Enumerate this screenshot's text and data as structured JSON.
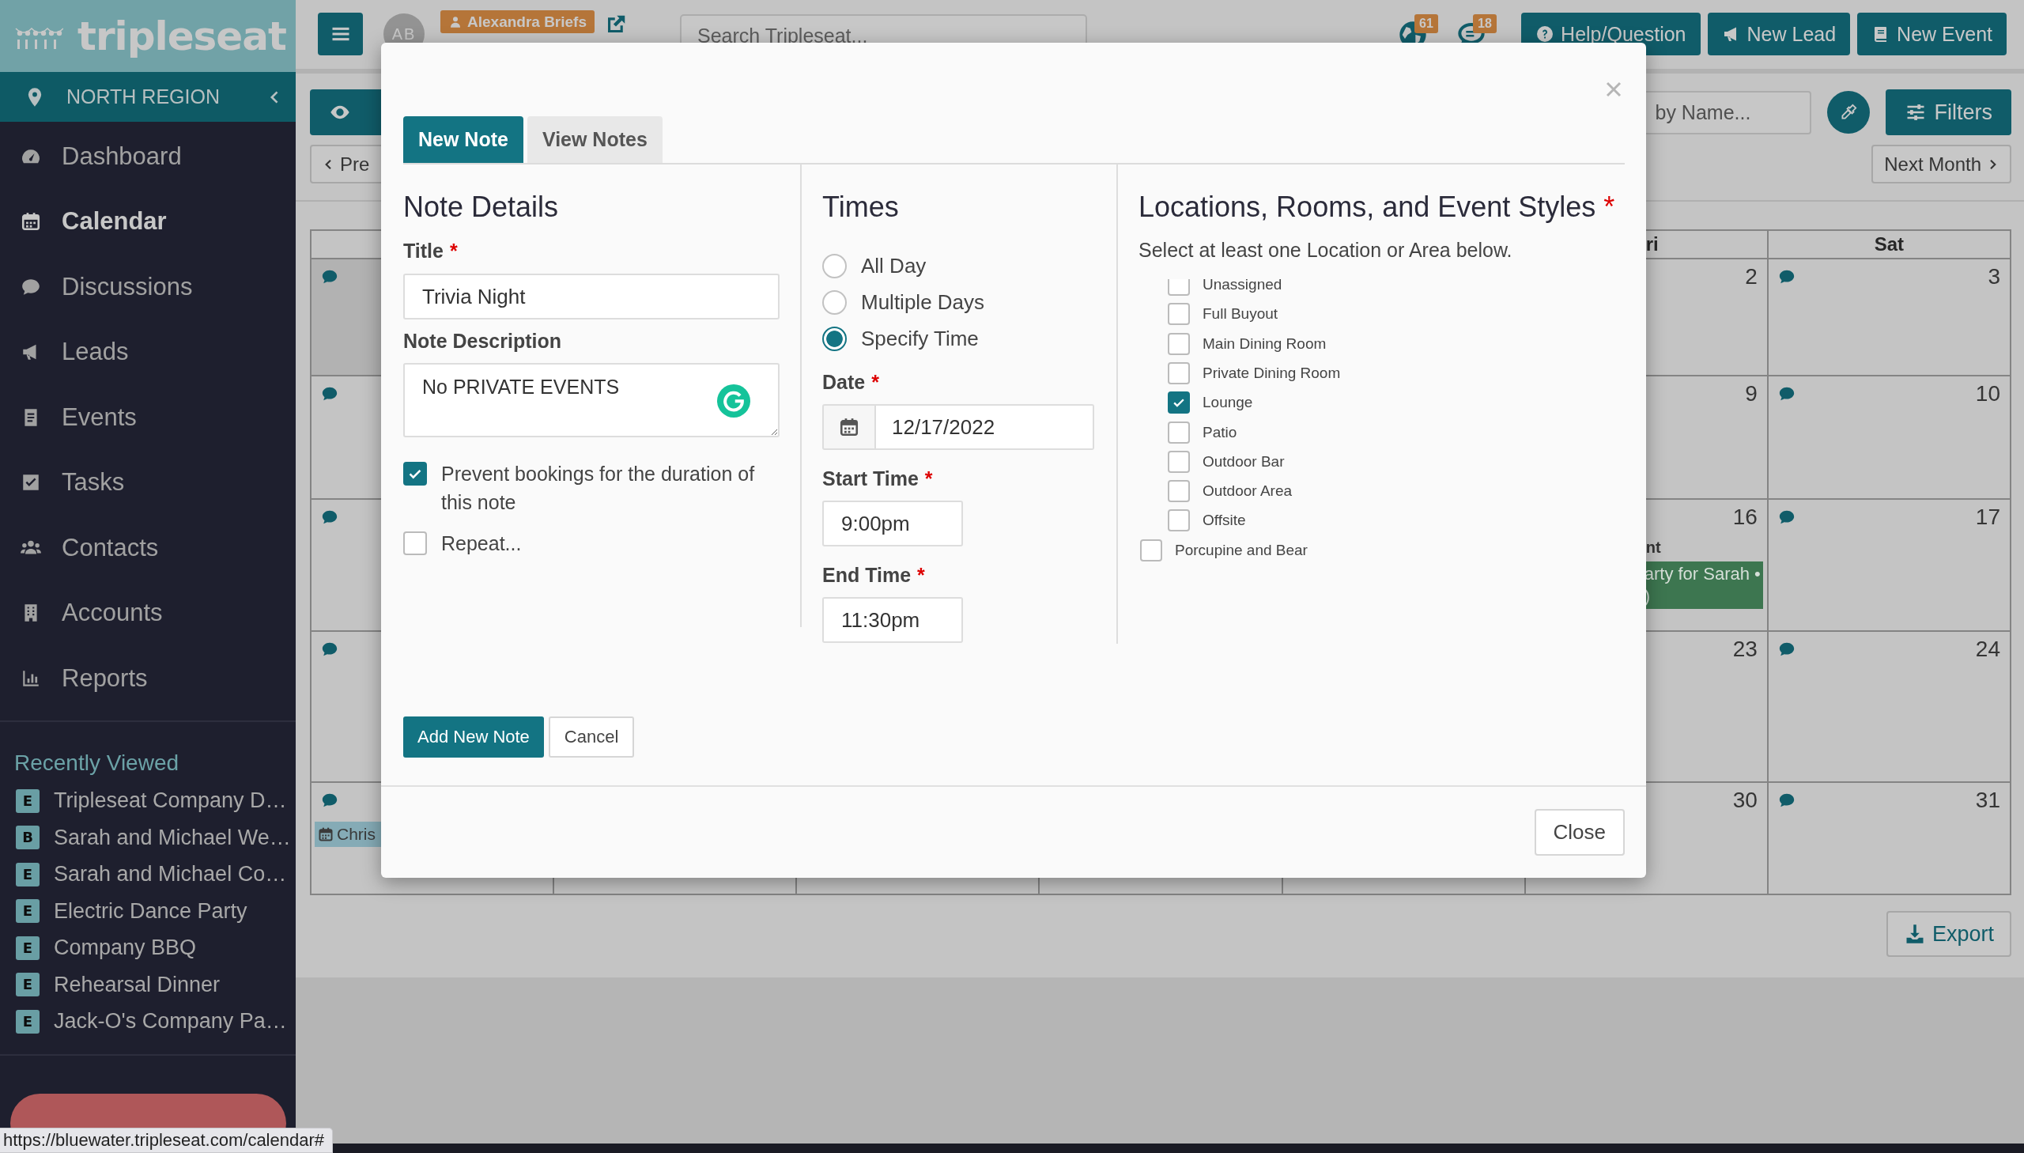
{
  "sidebar": {
    "logo": "tripleseat",
    "region": "NORTH REGION",
    "nav": [
      {
        "label": "Dashboard",
        "selected": false
      },
      {
        "label": "Calendar",
        "selected": true
      },
      {
        "label": "Discussions",
        "selected": false
      },
      {
        "label": "Leads",
        "selected": false
      },
      {
        "label": "Events",
        "selected": false
      },
      {
        "label": "Tasks",
        "selected": false
      },
      {
        "label": "Contacts",
        "selected": false
      },
      {
        "label": "Accounts",
        "selected": false
      },
      {
        "label": "Reports",
        "selected": false
      }
    ],
    "recently_viewed": {
      "title": "Recently Viewed",
      "items": [
        {
          "badge": "E",
          "label": "Tripleseat Company D…"
        },
        {
          "badge": "B",
          "label": "Sarah and Michael We…"
        },
        {
          "badge": "E",
          "label": "Sarah and Michael Co…"
        },
        {
          "badge": "E",
          "label": "Electric Dance Party"
        },
        {
          "badge": "E",
          "label": "Company BBQ"
        },
        {
          "badge": "E",
          "label": "Rehearsal Dinner"
        },
        {
          "badge": "E",
          "label": "Jack-O's Company Pa…"
        }
      ]
    }
  },
  "topbar": {
    "avatar": "AB",
    "user_badge": "Alexandra Briefs",
    "search": {
      "placeholder": "Search Tripleseat..."
    },
    "notifications": [
      {
        "count": "61"
      },
      {
        "count": "18"
      }
    ],
    "buttons": [
      {
        "label": "Help/Question"
      },
      {
        "label": "New Lead"
      },
      {
        "label": "New Event"
      }
    ]
  },
  "toolbar": {
    "prev_button": "Pre",
    "search": {
      "placeholder": "by Name..."
    },
    "filters_button": "Filters",
    "next_button": "Next Month",
    "export_button": "Export"
  },
  "calendar": {
    "headers": {
      "fri": "ri",
      "sat": "Sat"
    },
    "weeks": [
      {
        "sun": {
          "note": true,
          "other_month": true
        },
        "fri": {
          "day": "2"
        },
        "sat": {
          "day": "3",
          "note": true
        }
      },
      {
        "sun": {
          "note": true,
          "other_month": false
        },
        "fri": {
          "day": "9"
        },
        "sat": {
          "day": "10",
          "note": true
        }
      },
      {
        "sun": {
          "note": true,
          "other_month": false
        },
        "fri": {
          "day": "16",
          "caption": "nt",
          "events": [
            {
              "kind": "plain",
              "lines": [
                "arty for Sarah •",
                ")"
              ],
              "color": "#3d7650"
            }
          ]
        },
        "sat": {
          "day": "17",
          "note": true
        }
      },
      {
        "sun": {
          "note": true,
          "other_month": false
        },
        "fri": {
          "day": "23"
        },
        "sat": {
          "day": "24",
          "note": true
        }
      },
      {
        "sun": {
          "note": true,
          "other_month": false,
          "events": [
            {
              "kind": "calendar",
              "lines": [
                "Chris"
              ],
              "color": "#85abb6"
            }
          ]
        },
        "fri": {
          "day": "30"
        },
        "sat": {
          "day": "31",
          "note": true
        }
      }
    ]
  },
  "modal": {
    "tabs": [
      {
        "label": "New Note",
        "selected": true
      },
      {
        "label": "View Notes",
        "selected": false
      }
    ],
    "note_details": {
      "heading": "Note Details",
      "title": {
        "label": "Title",
        "required": "*",
        "value": "Trivia Night"
      },
      "description": {
        "label": "Note Description",
        "value": "No PRIVATE EVENTS"
      },
      "checkboxes": [
        {
          "label": "Prevent bookings for the duration of this note",
          "checked": true
        },
        {
          "label": "Repeat...",
          "checked": false
        }
      ]
    },
    "times": {
      "heading": "Times",
      "options": [
        {
          "label": "All Day",
          "selected": false
        },
        {
          "label": "Multiple Days",
          "selected": false
        },
        {
          "label": "Specify Time",
          "selected": true
        }
      ],
      "date": {
        "label": "Date",
        "required": "*",
        "value": "12/17/2022"
      },
      "start_time": {
        "label": "Start Time",
        "required": "*",
        "value": "9:00pm"
      },
      "end_time": {
        "label": "End Time",
        "required": "*",
        "value": "11:30pm"
      }
    },
    "locations": {
      "heading": "Locations, Rooms, and Event Styles",
      "required": "*",
      "hint": "Select at least one Location or Area below.",
      "items": [
        {
          "kind": "room",
          "label": "Unassigned",
          "checked": false
        },
        {
          "kind": "room",
          "label": "Full Buyout",
          "checked": false
        },
        {
          "kind": "room",
          "label": "Main Dining Room",
          "checked": false
        },
        {
          "kind": "room",
          "label": "Private Dining Room",
          "checked": false
        },
        {
          "kind": "room",
          "label": "Lounge",
          "checked": true
        },
        {
          "kind": "room",
          "label": "Patio",
          "checked": false
        },
        {
          "kind": "room",
          "label": "Outdoor Bar",
          "checked": false
        },
        {
          "kind": "room",
          "label": "Outdoor Area",
          "checked": false
        },
        {
          "kind": "room",
          "label": "Offsite",
          "checked": false
        },
        {
          "kind": "location",
          "label": "Porcupine and Bear",
          "checked": false
        }
      ]
    },
    "buttons": [
      {
        "label": "Add New Note",
        "kind": "primary"
      },
      {
        "label": "Cancel",
        "kind": "secondary"
      }
    ],
    "footer_button": "Close"
  },
  "status_url": "https://bluewater.tripleseat.com/calendar#"
}
